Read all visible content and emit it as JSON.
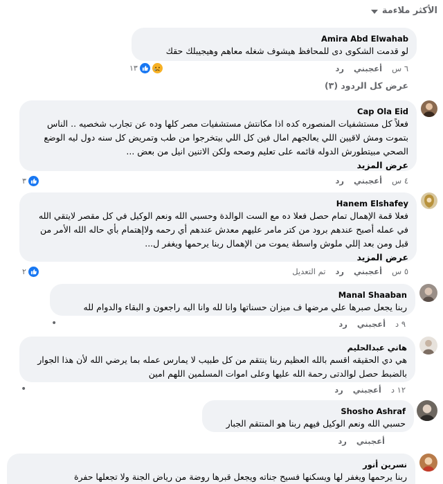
{
  "filter": {
    "label": "الأكثر ملاءمة",
    "icon": "caret-down-icon"
  },
  "comments": [
    {
      "author": "Amira Abd Elwahab",
      "text": "لو قدمت الشكوى دى للمحافظ هيشوف شغله معاهم وهيجيبلك حقك",
      "time": "٦ س",
      "like": "أعجبني",
      "reply": "رد",
      "reactions": "١٣",
      "view_replies": "عرض كل الردود (٣)"
    },
    {
      "author": "Cap Ola Eid",
      "text": "فعلاً كل مستشفيات المنصوره كده اذا مكانتش مستشفيات مصر كلها وده عن تجارب شخصيه .. الناس بتموت ومش لاقيين اللي يعالجهم امال فين كل اللي بيتخرجوا من طب وتمريض كل سنه دول ليه الوضع الصحي مبيتطورش الدوله قائمه على تعليم وصحه ولكن الاتنين انيل من بعض ...",
      "more": "عرض المزيد",
      "time": "٤ س",
      "like": "أعجبني",
      "reply": "رد",
      "reactions": "٣"
    },
    {
      "author": "Hanem Elshafey",
      "text": "فعلا قمة الإهمال تمام حصل فعلا ده مع الست الوالدة وحسبي الله ونعم الوكيل في كل مقصر لايتقي الله في عمله أصبح عندهم برود من كتر مامر عليهم معدش عندهم أي رحمه ولاإهتمام بأي حاله الله الأمر من قبل ومن بعد إللي ملوش واسطة يموت من الإهمال ربنا يرحمها ويغفر ل...",
      "more": "عرض المزيد",
      "time": "٥ س",
      "like": "أعجبني",
      "reply": "رد",
      "edited": "تم التعديل",
      "reactions": "٢"
    },
    {
      "author": "Manal Shaaban",
      "text": "ربنا يجعل صبرها علي مرضها ف ميزان حسناتها وانا لله وانا اليه راجعون و البقاء والدوام لله",
      "time": "٩ د",
      "like": "أعجبني",
      "reply": "رد",
      "dot": "•"
    },
    {
      "author": "هاني عبدالحليم",
      "text": "هي دي الحقيقه اقسم بالله العظيم ربنا ينتقم من كل طبيب لا يمارس عمله بما يرضي الله لأن هذا الجوار بالضبط حصل لوالدتى رحمة الله عليها وعلى اموات المسلمين اللهم امين",
      "time": "١٢ د",
      "like": "أعجبني",
      "reply": "رد",
      "dot": "•"
    },
    {
      "author": "Shosho Ashraf",
      "text": "حسبي الله ونعم الوكيل فيهم ربنا هو المنتقم الجبار",
      "time": "",
      "like": "أعجبني",
      "reply": "رد"
    },
    {
      "author": "نسرين أنور",
      "text": "ربنا يرحمها ويغفر لها ويسكنها فسيح جناته ويجعل قبرها روضة من رياض الجنة ولا تجعلها حفرة"
    }
  ],
  "colors": {
    "like": "#1877f2",
    "bubble": "#f0f2f5",
    "muted": "#65676b"
  }
}
